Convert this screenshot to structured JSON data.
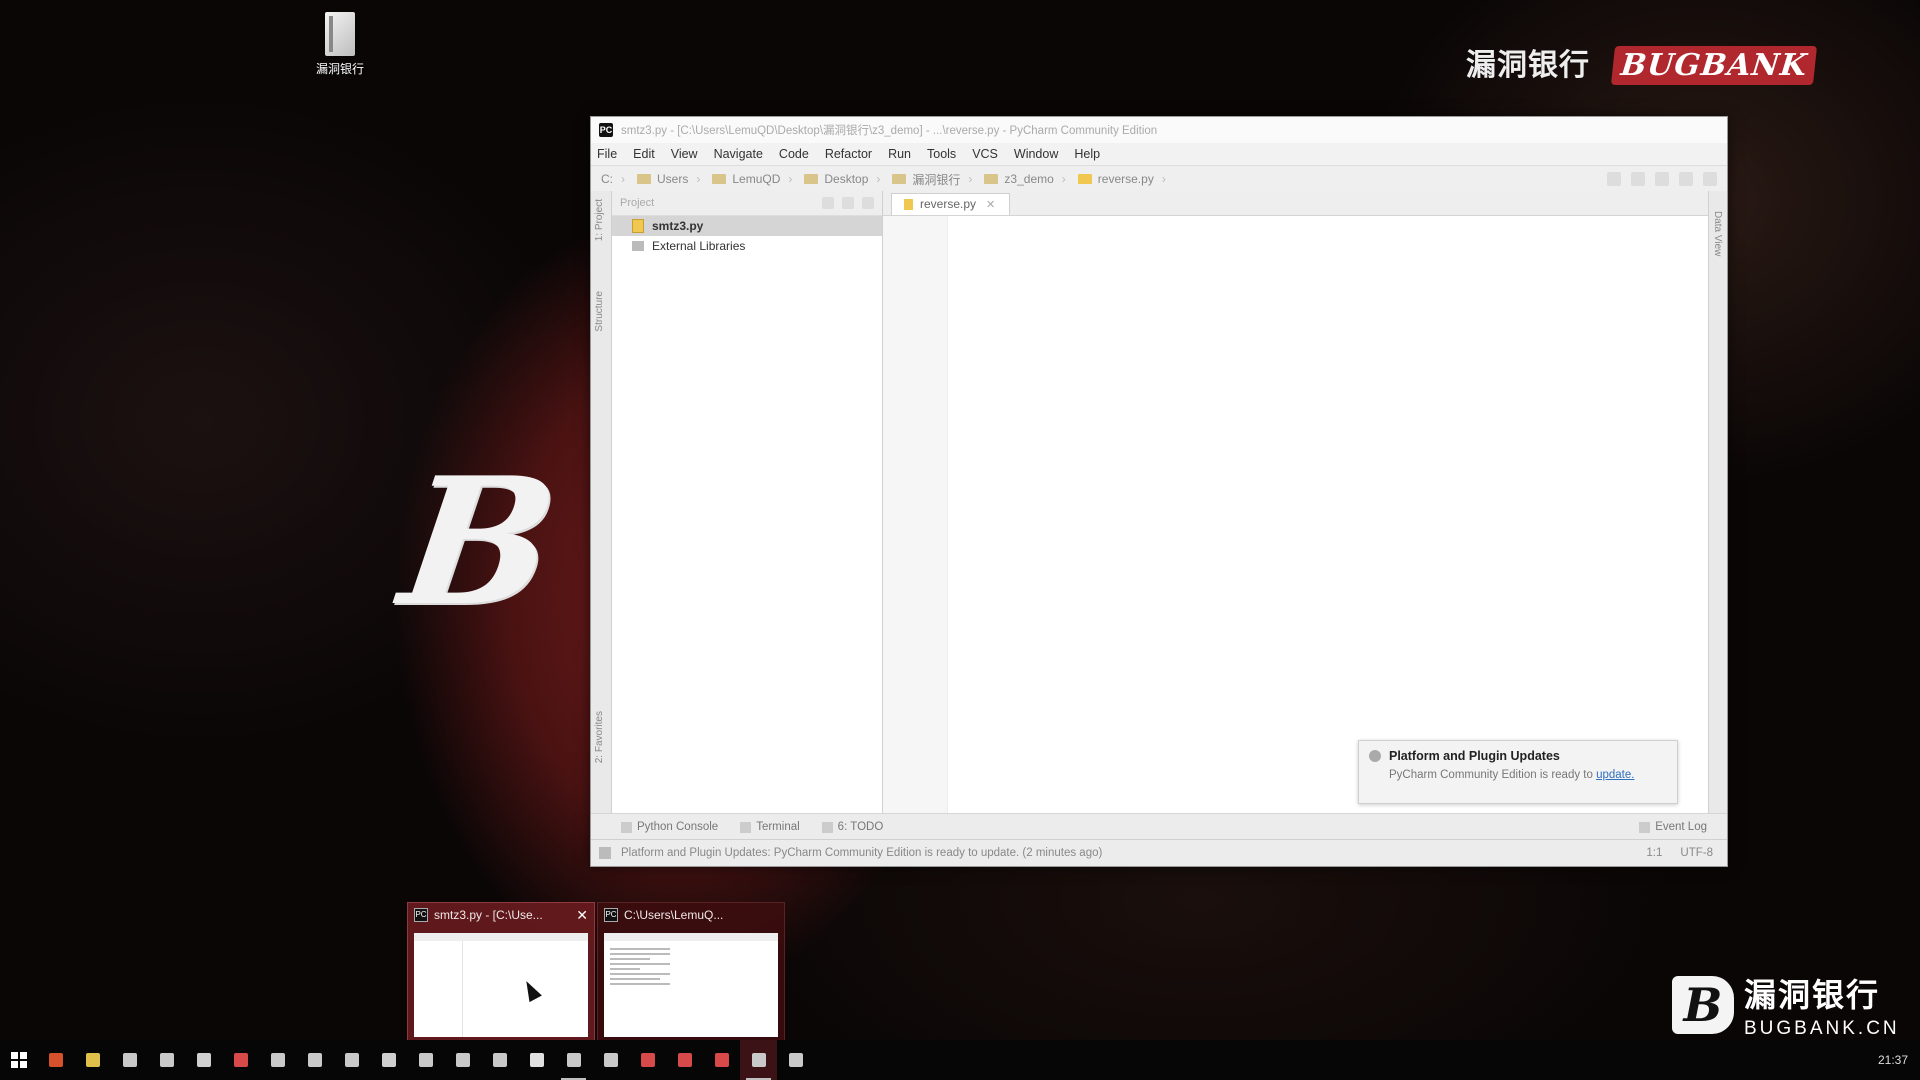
{
  "desktop": {
    "icon_label": "漏洞银行",
    "watermark_top": "漏洞银行",
    "watermark_brand": "BUGBANK",
    "watermark_bottom_cn": "漏洞银行",
    "watermark_bottom_en": "BUGBANK.CN",
    "watermark_logo": "B",
    "big_letter": "B"
  },
  "pycharm": {
    "titlebar_text": "smtz3.py - [C:\\Users\\LemuQD\\Desktop\\漏洞银行\\z3_demo] - ...\\reverse.py - PyCharm Community Edition",
    "menu": [
      "File",
      "Edit",
      "View",
      "Navigate",
      "Code",
      "Refactor",
      "Run",
      "Tools",
      "VCS",
      "Window",
      "Help"
    ],
    "breadcrumbs": [
      "C:",
      "Users",
      "LemuQD",
      "Desktop",
      "漏洞银行",
      "z3_demo",
      "reverse.py"
    ],
    "project_header": "Project",
    "tree": [
      {
        "label": "smtz3.py",
        "selected": true
      },
      {
        "label": "External Libraries",
        "selected": false
      }
    ],
    "left_strip_labels": [
      "1: Project",
      "Structure",
      "2: Favorites"
    ],
    "right_strip_label": "Data View",
    "editor_tab": "reverse.py",
    "notification": {
      "title": "Platform and Plugin Updates",
      "message": "PyCharm Community Edition is ready to",
      "link": "update."
    },
    "toolwindows": [
      "Python Console",
      "Terminal",
      "6: TODO"
    ],
    "event_log": "Event Log",
    "status_message": "Platform and Plugin Updates: PyCharm Community Edition is ready to update. (2 minutes ago)",
    "status_position": "1:1",
    "status_encoding": "UTF-8"
  },
  "previews": [
    {
      "title": "smtz3.py - [C:\\Use...",
      "close": "✕",
      "active": true
    },
    {
      "title": "C:\\Users\\LemuQ...",
      "close": "",
      "active": false
    }
  ],
  "taskbar": {
    "clock": "21:37",
    "icon_colors": [
      "#d8512d",
      "#e0c04a",
      "#c9c9c9",
      "#c9c9c9",
      "#d0d0d0",
      "#d84a4a",
      "#c9c9c9",
      "#c9c9c9",
      "#c9c9c9",
      "#d0d0d0",
      "#c9c9c9",
      "#c9c9c9",
      "#c9c9c9",
      "#e0e0e0",
      "#c9c9c9",
      "#c9c9c9",
      "#d84a4a",
      "#d84a4a",
      "#d84a4a",
      "#c9c9c9",
      "#c9c9c9"
    ]
  },
  "colors": {
    "accent_red": "#b0272d",
    "link_blue": "#2f6fbf"
  }
}
